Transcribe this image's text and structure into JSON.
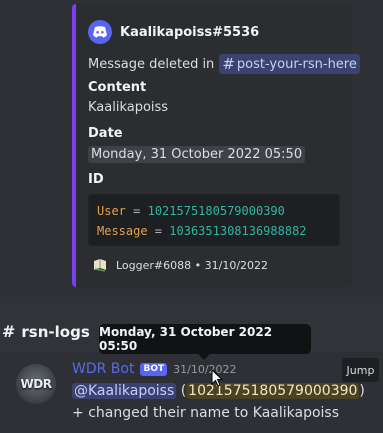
{
  "embed": {
    "author_name": "Kaalikapoiss#5536",
    "description_prefix": "Message deleted in",
    "channel_mention": "post-your-rsn-here",
    "fields": [
      {
        "name": "Content",
        "value": "Kaalikapoiss"
      },
      {
        "name": "Date",
        "value": "Monday, 31 October 2022 05:50"
      },
      {
        "name": "ID"
      }
    ],
    "code": [
      {
        "key": "User",
        "value": "1021575180579000390"
      },
      {
        "key": "Message",
        "value": "1036351308136988882"
      }
    ],
    "footer": "Logger#6088 • 31/10/2022",
    "accent_color": "#7b3ff2"
  },
  "channel": {
    "hash": "#",
    "name": "rsn-logs"
  },
  "tooltip": {
    "text": "Monday, 31 October 2022 05:50"
  },
  "message": {
    "author": "WDR Bot",
    "bot_tag": "BOT",
    "timestamp": "31/10/2022",
    "jump_label": "Jump",
    "avatar_text": "WDR",
    "mention": "@Kaalikapoiss",
    "id_text": "1021575180579000390",
    "text_tail": "changed their name to Kaalikapoiss"
  },
  "icons": {
    "author_avatar": "discord-logo-icon",
    "footer_icon": "book-icon",
    "cursor": "mouse-pointer-icon"
  }
}
